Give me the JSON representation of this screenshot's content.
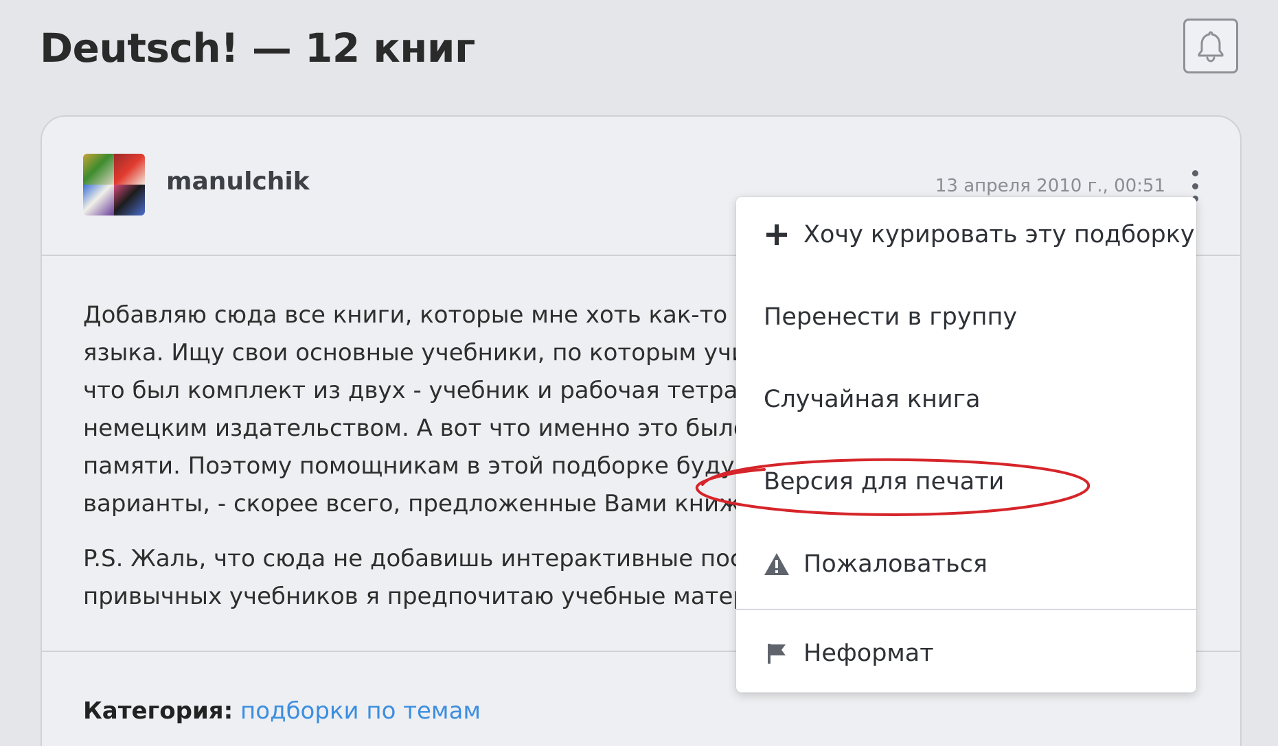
{
  "page": {
    "title": "Deutsch! — 12 книг"
  },
  "icons": {
    "notification": "bell-icon",
    "more": "kebab-menu-icon",
    "curate": "plus-icon",
    "report": "warning-triangle-icon",
    "offtopic": "flag-icon"
  },
  "post": {
    "author": "manulchik",
    "date": "13 апреля 2010 г., 00:51",
    "paragraphs": [
      {
        "lines": [
          "Добавляю сюда все книги, которые мне хоть как-то по",
          "языка. Ищу свои основные учебники, по которым учил",
          "что был комплект из двух - учебник и рабочая тетрадь",
          "немецким издательством. А вот что именно это было -",
          "памяти. Поэтому помощникам в этой подборке буду о",
          "варианты, - скорее всего, предложенные Вами книжк"
        ]
      },
      {
        "lines": [
          "P.S. Жаль, что сюда не добавишь интерактивные посо",
          "привычных учебников я предпочитаю учебные матери"
        ]
      }
    ],
    "category_label": "Категория:",
    "category_link": "подборки по темам"
  },
  "menu": {
    "items": [
      {
        "label": "Хочу курировать эту подборку",
        "icon": "plus-icon"
      },
      {
        "label": "Перенести в группу"
      },
      {
        "label": "Случайная книга"
      },
      {
        "label": "Версия для печати",
        "highlighted": true
      },
      {
        "label": "Пожаловаться",
        "icon": "warning-triangle-icon"
      },
      {
        "label": "Неформат",
        "icon": "flag-icon"
      }
    ]
  },
  "colors": {
    "background": "#e5e6e9",
    "card": "#eeeff2",
    "link": "#3b8ee0",
    "highlight_ellipse": "#d6252a"
  }
}
